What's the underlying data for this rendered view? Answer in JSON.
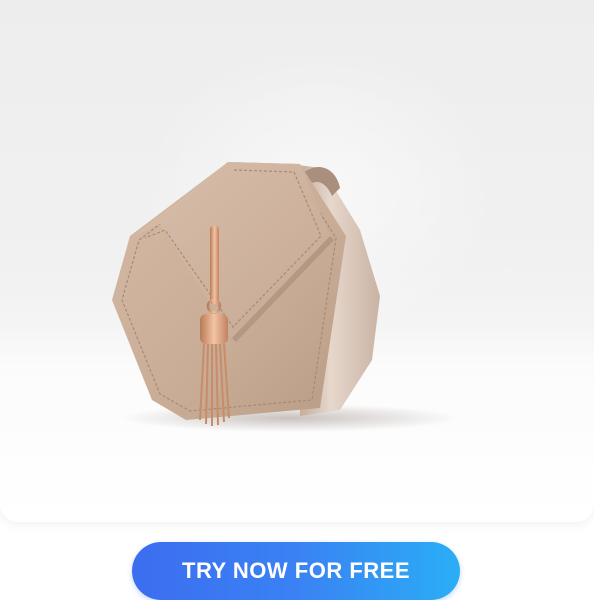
{
  "product": {
    "image_subject": "beige hexagonal leather crossbody handbag with rose-gold tassel"
  },
  "cta": {
    "label": "TRY NOW FOR FREE"
  },
  "colors": {
    "button_gradient_start": "#3c6df0",
    "button_gradient_end": "#2aaef5",
    "button_text": "#ffffff",
    "bag_leather": "#c9ae98",
    "tassel_gold": "#d9a07c"
  }
}
